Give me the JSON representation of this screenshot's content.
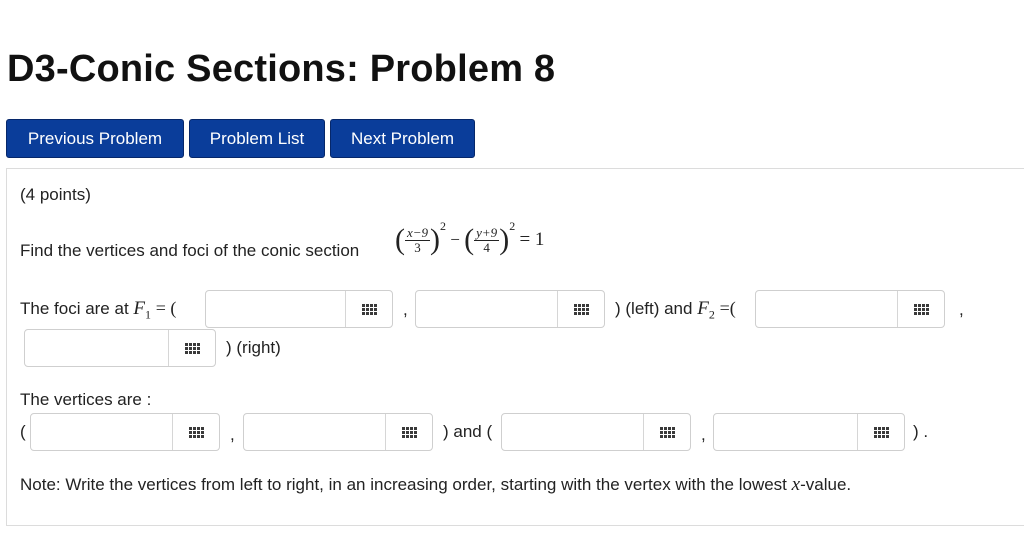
{
  "page": {
    "title": "D3-Conic Sections: Problem 8"
  },
  "nav": {
    "previous": "Previous Problem",
    "list": "Problem List",
    "next": "Next Problem"
  },
  "problem": {
    "points": "(4 points)",
    "prompt": "Find the vertices and foci of the conic section",
    "equation": {
      "frac1_num": "x−9",
      "frac1_den": "3",
      "frac2_num": "y+9",
      "frac2_den": "4",
      "exp": "2",
      "minus": "−",
      "rhs": "= 1"
    },
    "foci": {
      "lead": "The foci are at",
      "f1_symbol": "F",
      "f1_sub": "1",
      "eq_open": "= (",
      "mid_left": ") (left) and",
      "f2_symbol": "F",
      "f2_sub": "2",
      "eq_open2": "=(",
      "comma": ",",
      "close_right": ") (right)"
    },
    "vertices": {
      "lead": "The vertices are :",
      "open": "(",
      "comma": ",",
      "and_open": ") and (",
      "close": ") ."
    },
    "note": {
      "before": "Note: Write the vertices from left to right, in an increasing order, starting with the vertex with the lowest",
      "var": "x",
      "after": "-value."
    }
  },
  "inputs": {
    "f1_x": "",
    "f1_y": "",
    "f2_x": "",
    "f2_y": "",
    "v1_x": "",
    "v1_y": "",
    "v2_x": "",
    "v2_y": ""
  },
  "colors": {
    "button_bg": "#0a3d9a",
    "button_text": "#ffffff"
  }
}
